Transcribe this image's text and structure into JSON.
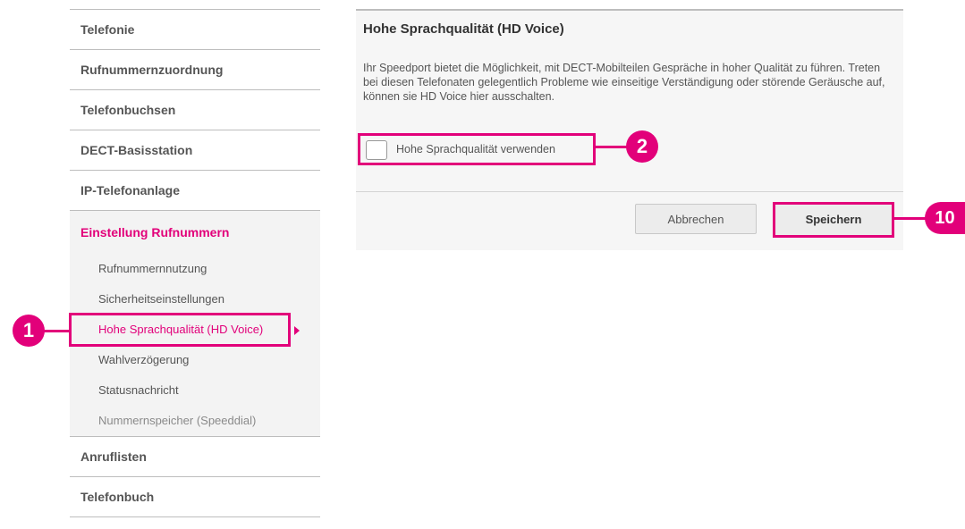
{
  "sidebar": {
    "items_top": [
      {
        "label": "Telefonie"
      },
      {
        "label": "Rufnummernzuordnung"
      },
      {
        "label": "Telefonbuchsen"
      },
      {
        "label": "DECT-Basisstation"
      },
      {
        "label": "IP-Telefonanlage"
      }
    ],
    "group": {
      "title": "Einstellung Rufnummern",
      "items": [
        {
          "label": "Rufnummernnutzung"
        },
        {
          "label": "Sicherheitseinstellungen"
        },
        {
          "label": "Hohe Sprachqualität (HD Voice)"
        },
        {
          "label": "Wahlverzögerung"
        },
        {
          "label": "Statusnachricht"
        },
        {
          "label": "Nummernspeicher (Speeddial)"
        }
      ]
    },
    "items_bottom": [
      {
        "label": "Anruflisten"
      },
      {
        "label": "Telefonbuch"
      }
    ]
  },
  "main": {
    "title": "Hohe Sprachqualität (HD Voice)",
    "description": "Ihr Speedport bietet die Möglichkeit, mit DECT-Mobilteilen Gespräche in hoher Qualität zu führen. Treten bei diesen Telefonaten gelegentlich Probleme wie einseitige Verständigung oder störende Geräusche auf, können sie HD Voice hier ausschalten.",
    "checkbox": {
      "label": "Hohe Sprachqualität verwenden",
      "checked": false
    },
    "cancel_label": "Abbrechen",
    "save_label": "Speichern"
  },
  "callouts": {
    "one": "1",
    "two": "2",
    "three": "10"
  },
  "colors": {
    "accent": "#e2007a"
  }
}
